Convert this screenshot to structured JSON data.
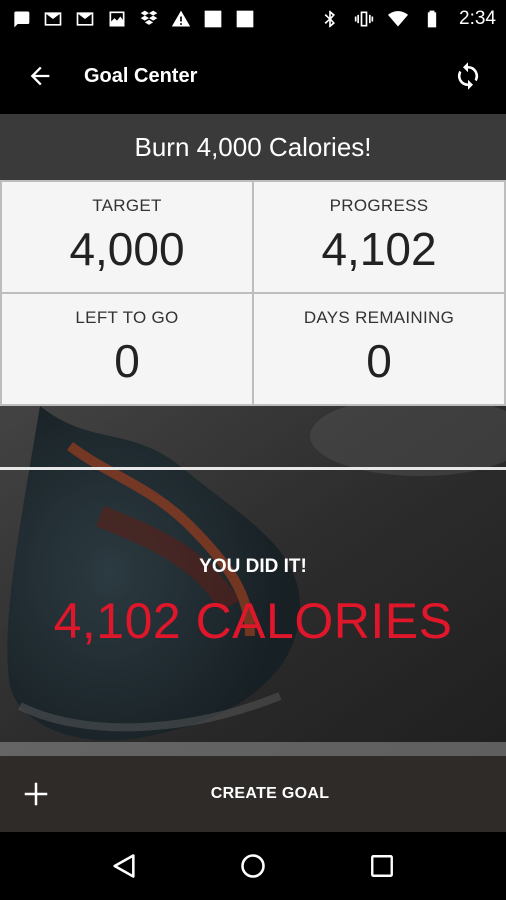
{
  "status_bar": {
    "time": "2:34",
    "left_icons": [
      "message-icon",
      "gmail-icon",
      "gmail-icon",
      "image-icon",
      "dropbox-icon",
      "warning-icon",
      "square-icon",
      "square-icon"
    ],
    "right_icons": [
      "bluetooth-icon",
      "vibrate-icon",
      "wifi-icon",
      "battery-icon"
    ]
  },
  "app_bar": {
    "title": "Goal Center"
  },
  "goal": {
    "title": "Burn 4,000 Calories!",
    "stats": [
      {
        "label": "TARGET",
        "value": "4,000"
      },
      {
        "label": "PROGRESS",
        "value": "4,102"
      },
      {
        "label": "LEFT TO GO",
        "value": "0"
      },
      {
        "label": "DAYS REMAINING",
        "value": "0"
      }
    ]
  },
  "hero": {
    "headline": "YOU DID IT!",
    "amount": "4,102 CALORIES",
    "amount_color": "#e0162b"
  },
  "create_bar": {
    "label": "CREATE GOAL"
  },
  "colors": {
    "accent": "#e0162b",
    "goal_title_bg": "#3a3a3a",
    "create_bar_bg": "#2e2b29"
  }
}
